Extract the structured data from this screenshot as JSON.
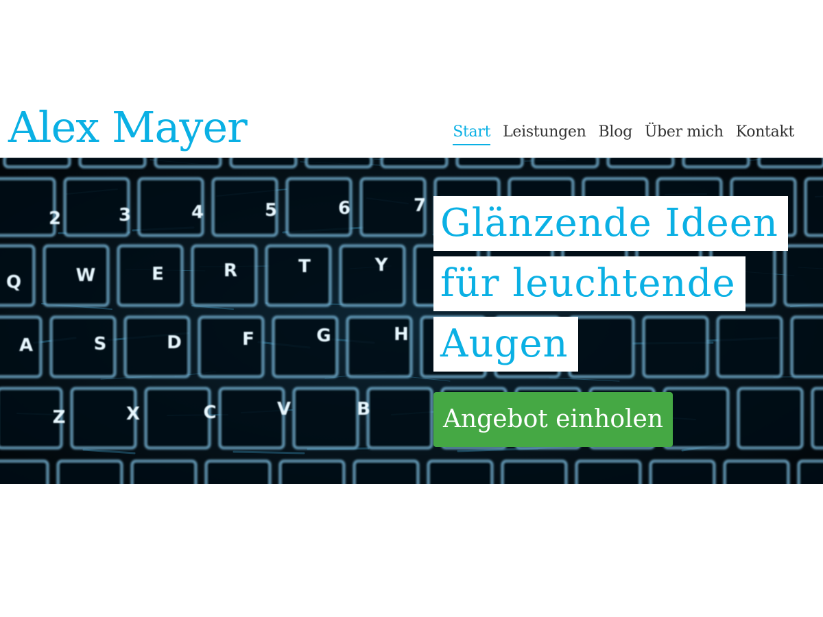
{
  "site": {
    "name": "Alex Mayer"
  },
  "nav": {
    "items": [
      {
        "label": "Start",
        "active": true
      },
      {
        "label": "Leistungen",
        "active": false
      },
      {
        "label": "Blog",
        "active": false
      },
      {
        "label": "Über mich",
        "active": false
      },
      {
        "label": "Kontakt",
        "active": false
      }
    ]
  },
  "hero": {
    "headline_lines": [
      "Glänzende Ideen",
      "für leuchtende",
      "Augen"
    ],
    "cta_label": "Angebot einholen",
    "image": "glowing-keyboard-background",
    "keycaps": [
      "Q",
      "W",
      "E",
      "R",
      "T",
      "Y",
      "A",
      "S",
      "D",
      "F",
      "G",
      "H",
      "Z",
      "X",
      "C",
      "V",
      "B",
      "2",
      "3",
      "4",
      "5",
      "6",
      "7"
    ]
  },
  "colors": {
    "brand": "#0ab0e4",
    "nav_text": "#333333",
    "cta_background": "#45a844",
    "cta_text": "#ffffff",
    "headline_background": "#ffffff",
    "hero_background": "#020910"
  }
}
